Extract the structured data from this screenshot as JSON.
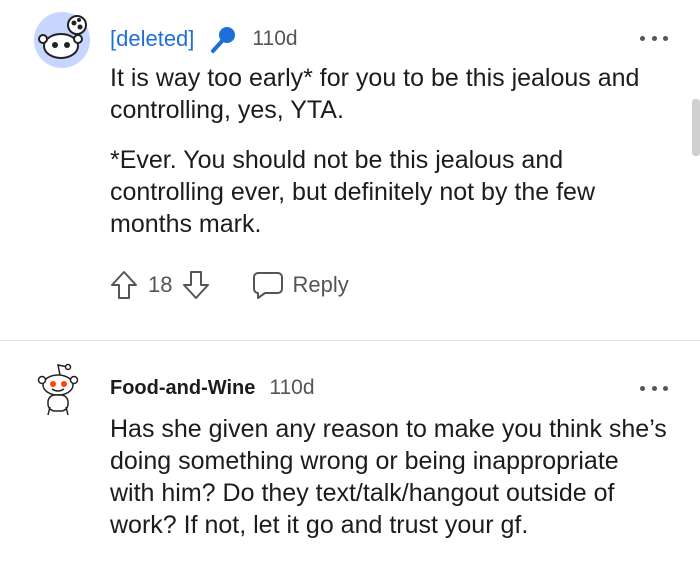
{
  "comments": [
    {
      "username": "[deleted]",
      "age": "110d",
      "body": [
        "It is way too early* for you to be this jealous and controlling, yes, YTA.",
        "*Ever. You should not be this jealous and controlling ever, but definitely not by the few months mark."
      ],
      "votes": "18",
      "reply_label": "Reply",
      "accent_color": "#1e70d8",
      "icons": {
        "badge": "microphone-icon",
        "upvote": "arrow-up-icon",
        "downvote": "arrow-down-icon",
        "reply": "speech-bubble-icon"
      }
    },
    {
      "username": "Food-and-Wine",
      "age": "110d",
      "body": [
        "Has she given any reason to make you think she’s doing something wrong or being inappropriate with him? Do they text/talk/hangout outside of work? If not, let it go and trust your gf."
      ],
      "icons": {
        "avatar": "snoo-avatar-icon",
        "more": "more-options-icon"
      }
    }
  ]
}
